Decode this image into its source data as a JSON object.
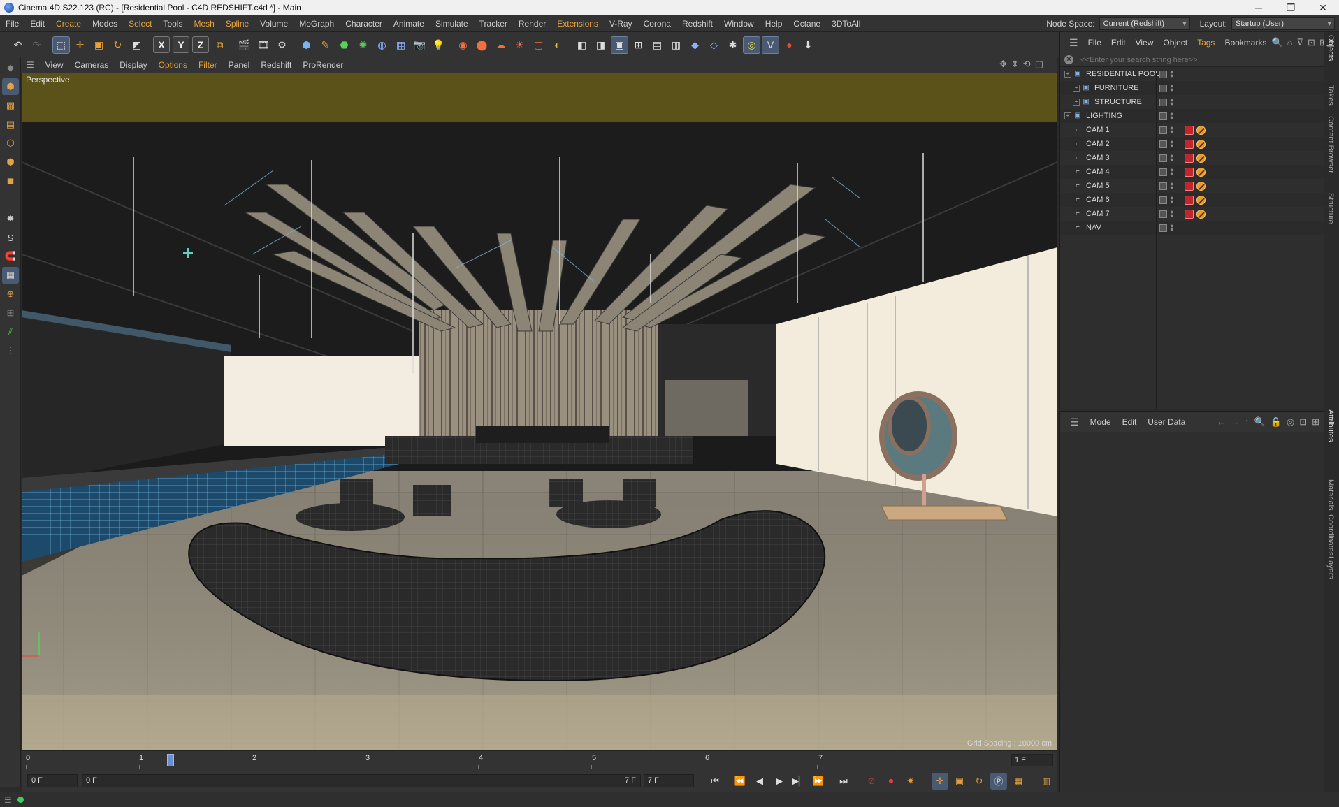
{
  "window": {
    "title": "Cinema 4D S22.123 (RC) - [Residential Pool - C4D REDSHIFT.c4d *] - Main",
    "minimize": "─",
    "maximize": "❐",
    "close": "✕"
  },
  "menubar": {
    "items": [
      "File",
      "Edit",
      "Create",
      "Modes",
      "Select",
      "Tools",
      "Mesh",
      "Spline",
      "Volume",
      "MoGraph",
      "Character",
      "Animate",
      "Simulate",
      "Tracker",
      "Render",
      "Extensions",
      "V-Ray",
      "Corona",
      "Redshift",
      "Window",
      "Help",
      "Octane",
      "3DToAll"
    ],
    "highlighted": [
      "Create",
      "Select",
      "Mesh",
      "Spline",
      "Extensions"
    ],
    "node_space_label": "Node Space:",
    "node_space_value": "Current (Redshift)",
    "layout_label": "Layout:",
    "layout_value": "Startup (User)"
  },
  "toolbar": {
    "axis_x": "X",
    "axis_y": "Y",
    "axis_z": "Z"
  },
  "viewport_menu": {
    "items": [
      "View",
      "Cameras",
      "Display",
      "Options",
      "Filter",
      "Panel",
      "Redshift",
      "ProRender"
    ],
    "highlighted": [
      "Options",
      "Filter"
    ]
  },
  "viewport": {
    "label": "Perspective",
    "grid_spacing": "Grid Spacing : 10000 cm"
  },
  "timeline": {
    "ticks": [
      "0",
      "1",
      "2",
      "3",
      "4",
      "5",
      "6",
      "7"
    ],
    "end_field": "1 F"
  },
  "transport": {
    "current_frame": "0 F",
    "range_start": "0 F",
    "range_end": "7 F",
    "max_frame": "7 F"
  },
  "object_panel": {
    "menu": [
      "File",
      "Edit",
      "View",
      "Object",
      "Tags",
      "Bookmarks"
    ],
    "highlighted": [
      "Tags"
    ],
    "search_placeholder": "<<Enter your search string here>>",
    "objects": [
      {
        "name": "RESIDENTIAL POOL",
        "type": "layer",
        "indent": 0,
        "tags": []
      },
      {
        "name": "FURNITURE",
        "type": "layer",
        "indent": 1,
        "tags": []
      },
      {
        "name": "STRUCTURE",
        "type": "layer",
        "indent": 1,
        "tags": []
      },
      {
        "name": "LIGHTING",
        "type": "layer",
        "indent": 0,
        "tags": []
      },
      {
        "name": "CAM 1",
        "type": "camera",
        "indent": 0,
        "tags": [
          "red",
          "orange"
        ]
      },
      {
        "name": "CAM 2",
        "type": "camera",
        "indent": 0,
        "tags": [
          "red",
          "orange"
        ]
      },
      {
        "name": "CAM 3",
        "type": "camera",
        "indent": 0,
        "tags": [
          "red",
          "orange"
        ]
      },
      {
        "name": "CAM 4",
        "type": "camera",
        "indent": 0,
        "tags": [
          "red",
          "orange"
        ]
      },
      {
        "name": "CAM 5",
        "type": "camera",
        "indent": 0,
        "tags": [
          "red",
          "orange"
        ]
      },
      {
        "name": "CAM 6",
        "type": "camera",
        "indent": 0,
        "tags": [
          "red",
          "orange"
        ]
      },
      {
        "name": "CAM 7",
        "type": "camera",
        "indent": 0,
        "tags": [
          "red",
          "orange"
        ]
      },
      {
        "name": "NAV",
        "type": "camera",
        "indent": 0,
        "tags": []
      }
    ]
  },
  "attributes_panel": {
    "menu": [
      "Mode",
      "Edit",
      "User Data"
    ]
  },
  "side_tabs": {
    "top": [
      "Objects",
      "Takes",
      "Content Browser",
      "Structure"
    ],
    "bottom": [
      "Attributes",
      "Materials",
      "Coordinates",
      "Layers"
    ]
  },
  "colors": {
    "accent": "#e8a33a",
    "selection": "#4a5a72",
    "status_ok": "#3ecf5a"
  }
}
